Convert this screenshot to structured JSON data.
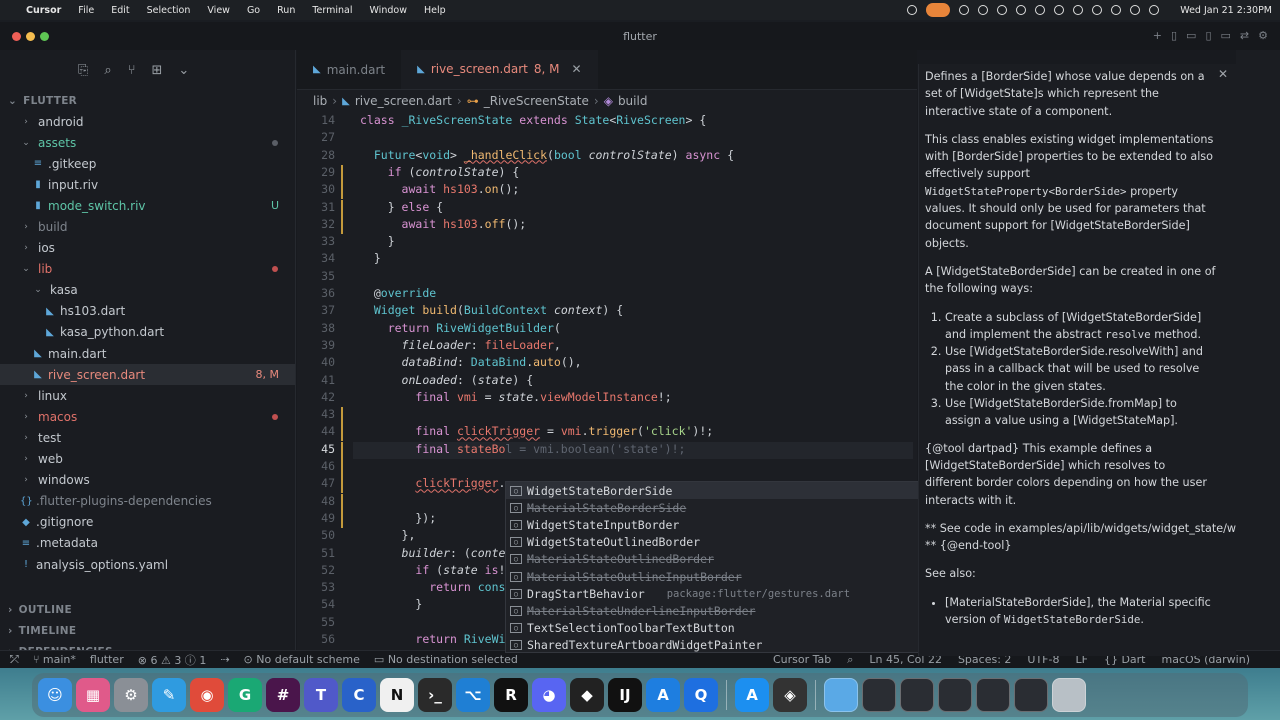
{
  "menubar": {
    "app": "Cursor",
    "items": [
      "File",
      "Edit",
      "Selection",
      "View",
      "Go",
      "Run",
      "Terminal",
      "Window",
      "Help"
    ],
    "datetime": "Wed Jan 21  2:30PM"
  },
  "window": {
    "title": "flutter"
  },
  "sidebar": {
    "root": "FLUTTER",
    "items": [
      {
        "label": "android",
        "chev": "›",
        "depth": 0
      },
      {
        "label": "assets",
        "chev": "⌄",
        "depth": 0,
        "color": "#5ec5a7",
        "dot": "grey"
      },
      {
        "label": ".gitkeep",
        "depth": 1,
        "icon": "≡"
      },
      {
        "label": "input.riv",
        "depth": 1,
        "icon": "▮"
      },
      {
        "label": "mode_switch.riv",
        "depth": 1,
        "icon": "▮",
        "color": "#5ec5a7",
        "badge": "U",
        "badgeColor": "#5ec5a7"
      },
      {
        "label": "build",
        "chev": "›",
        "depth": 0,
        "color": "#7e848c"
      },
      {
        "label": "ios",
        "chev": "›",
        "depth": 0
      },
      {
        "label": "lib",
        "chev": "⌄",
        "depth": 0,
        "color": "#e0726a",
        "dot": "red"
      },
      {
        "label": "kasa",
        "chev": "⌄",
        "depth": 1
      },
      {
        "label": "hs103.dart",
        "depth": 2,
        "icon": "◣"
      },
      {
        "label": "kasa_python.dart",
        "depth": 2,
        "icon": "◣"
      },
      {
        "label": "main.dart",
        "depth": 1,
        "icon": "◣"
      },
      {
        "label": "rive_screen.dart",
        "depth": 1,
        "icon": "◣",
        "color": "#e88a7d",
        "badge": "8, M",
        "badgeColor": "#e88a7d",
        "sel": true
      },
      {
        "label": "linux",
        "chev": "›",
        "depth": 0
      },
      {
        "label": "macos",
        "chev": "›",
        "depth": 0,
        "color": "#e0726a",
        "dot": "red"
      },
      {
        "label": "test",
        "chev": "›",
        "depth": 0
      },
      {
        "label": "web",
        "chev": "›",
        "depth": 0
      },
      {
        "label": "windows",
        "chev": "›",
        "depth": 0
      },
      {
        "label": ".flutter-plugins-dependencies",
        "depth": 0,
        "icon": "{}",
        "color": "#7e848c"
      },
      {
        "label": ".gitignore",
        "depth": 0,
        "icon": "◆"
      },
      {
        "label": ".metadata",
        "depth": 0,
        "icon": "≡"
      },
      {
        "label": "analysis_options.yaml",
        "depth": 0,
        "icon": "!"
      }
    ],
    "sections": [
      "OUTLINE",
      "TIMELINE",
      "DEPENDENCIES"
    ]
  },
  "tabs": [
    {
      "label": "main.dart",
      "badge": ""
    },
    {
      "label": "rive_screen.dart",
      "badge": "8, M"
    }
  ],
  "breadcrumb": [
    "lib",
    "rive_screen.dart",
    "_RiveScreenState",
    "build"
  ],
  "editor": {
    "lines": [
      {
        "n": "14",
        "h": "<span class='k'>class</span> <span class='t'>_RiveScreenState</span> <span class='k'>extends</span> <span class='t'>State</span>&lt;<span class='t'>RiveScreen</span>&gt; {"
      },
      {
        "n": "27",
        "h": ""
      },
      {
        "n": "28",
        "h": "  <span class='t'>Future</span>&lt;<span class='t'>void</span>&gt; <span class='f wav'>_handleClick</span>(<span class='t'>bool</span> <span class='i'>controlState</span>) <span class='k'>async</span> {"
      },
      {
        "n": "29",
        "h": "    <span class='k'>if</span> (<span class='i'>controlState</span>) {",
        "gm": true
      },
      {
        "n": "30",
        "h": "      <span class='k'>await</span> <span class='v'>hs103</span>.<span class='f'>on</span>();",
        "gm": true
      },
      {
        "n": "31",
        "h": "    } <span class='k'>else</span> {",
        "gm": true
      },
      {
        "n": "32",
        "h": "      <span class='k'>await</span> <span class='v'>hs103</span>.<span class='f'>off</span>();",
        "gm": true
      },
      {
        "n": "33",
        "h": "    }"
      },
      {
        "n": "34",
        "h": "  }"
      },
      {
        "n": "35",
        "h": ""
      },
      {
        "n": "36",
        "h": "  @<span class='t'>override</span>"
      },
      {
        "n": "37",
        "h": "  <span class='t'>Widget</span> <span class='f'>build</span>(<span class='t'>BuildContext</span> <span class='i'>context</span>) {"
      },
      {
        "n": "38",
        "h": "    <span class='k'>return</span> <span class='t'>RiveWidgetBuilder</span>("
      },
      {
        "n": "39",
        "h": "      <span class='i'>fileLoader</span>: <span class='v'>fileLoader</span>,"
      },
      {
        "n": "40",
        "h": "      <span class='i'>dataBind</span>: <span class='t'>DataBind</span>.<span class='f'>auto</span>(),"
      },
      {
        "n": "41",
        "h": "      <span class='i'>onLoaded</span>: (<span class='i'>state</span>) {"
      },
      {
        "n": "42",
        "h": "        <span class='k'>final</span> <span class='v'>vmi</span> = <span class='i'>state</span>.<span class='v'>viewModelInstance</span>!;"
      },
      {
        "n": "43",
        "h": "",
        "gm": true
      },
      {
        "n": "44",
        "h": "        <span class='k'>final</span> <span class='v wav'>clickTrigger</span> = <span class='v'>vmi</span>.<span class='f'>trigger</span>(<span class='s'>'click'</span>)!;",
        "gm": true
      },
      {
        "n": "45",
        "h": "        <span class='k'>final</span> <span class='v'>stateBo</span><span class='g'>l = vmi.boolean('state')!;</span>",
        "gm": true,
        "cur": true
      },
      {
        "n": "46",
        "h": "",
        "gm": true
      },
      {
        "n": "47",
        "h": "        <span class='v wav'>clickTrigger</span>.",
        "gm": true
      },
      {
        "n": "48",
        "h": "",
        "gm": true
      },
      {
        "n": "49",
        "h": "        });",
        "gm": true
      },
      {
        "n": "50",
        "h": "      },"
      },
      {
        "n": "51",
        "h": "      <span class='i'>builder</span>: (<span class='i'>conte</span>"
      },
      {
        "n": "52",
        "h": "        <span class='k'>if</span> (<span class='i'>state</span> <span class='k'>is</span>!"
      },
      {
        "n": "53",
        "h": "          <span class='k'>return</span> <span class='t'>cons</span>"
      },
      {
        "n": "54",
        "h": "        }"
      },
      {
        "n": "55",
        "h": ""
      },
      {
        "n": "56",
        "h": "        <span class='k'>return</span> <span class='t'>RiveWidget</span>(<span class='i'>controller</span>: <span class='i'>state</span>.<span class='v'>controller</span>);"
      }
    ]
  },
  "autocomplete": [
    {
      "label": "WidgetStateBorderSide",
      "deprecated": false,
      "sel": true,
      "pkg": ""
    },
    {
      "label": "MaterialStateBorderSide",
      "deprecated": true,
      "pkg": ""
    },
    {
      "label": "WidgetStateInputBorder",
      "deprecated": false,
      "pkg": ""
    },
    {
      "label": "WidgetStateOutlinedBorder",
      "deprecated": false,
      "pkg": ""
    },
    {
      "label": "MaterialStateOutlinedBorder",
      "deprecated": true,
      "pkg": ""
    },
    {
      "label": "MaterialStateOutlineInputBorder",
      "deprecated": true,
      "pkg": ""
    },
    {
      "label": "DragStartBehavior",
      "deprecated": false,
      "pkg": "package:flutter/gestures.dart"
    },
    {
      "label": "MaterialStateUnderlineInputBorder",
      "deprecated": true,
      "pkg": ""
    },
    {
      "label": "TextSelectionToolbarTextButton",
      "deprecated": false,
      "pkg": ""
    },
    {
      "label": "SharedTextureArtboardWidgetPainter",
      "deprecated": false,
      "pkg": ""
    }
  ],
  "docs": {
    "p1": "Defines a [BorderSide] whose value depends on a set of [WidgetState]s which represent the interactive state of a component.",
    "p2a": "This class enables existing widget implementations with [BorderSide] properties to be extended to also effectively support",
    "p2code": "WidgetStateProperty<BorderSide>",
    "p2b": "property values. It should only be used for parameters that document support for [WidgetStateBorderSide] objects.",
    "p3": "A [WidgetStateBorderSide] can be created in one of the following ways:",
    "li1a": "Create a subclass of [WidgetStateBorderSide] and implement the abstract",
    "li1code": "resolve",
    "li1b": "method.",
    "li2": "Use [WidgetStateBorderSide.resolveWith] and pass in a callback that will be used to resolve the color in the given states.",
    "li3": "Use [WidgetStateBorderSide.fromMap] to assign a value using a [WidgetStateMap].",
    "p4": "{@tool dartpad} This example defines a [WidgetStateBorderSide] which resolves to different border colors depending on how the user interacts with it.",
    "p5a": "** See code in examples/api/lib/widgets/widget_state/widget_state_",
    "p5b": "** {@end-tool}",
    "p6": "See also:",
    "li4a": "[MaterialStateBorderSide], the Material specific version of",
    "li4code": "WidgetStateBorderSide",
    "li4b": "."
  },
  "status": {
    "branch": "main*",
    "project": "flutter",
    "errors": "6",
    "warnings": "3",
    "infos": "1",
    "scheme": "No default scheme",
    "destination": "No destination selected",
    "cursor_tab": "Cursor Tab",
    "position": "Ln 45, Col 22",
    "spaces": "Spaces: 2",
    "encoding": "UTF-8",
    "eol": "LF",
    "language": "Dart",
    "platform": "macOS (darwin)"
  },
  "dock": [
    {
      "name": "finder",
      "c": "#3b8fe0",
      "g": "☺"
    },
    {
      "name": "launchpad",
      "c": "#e05a8a",
      "g": "▦"
    },
    {
      "name": "system-settings",
      "c": "#8a8f96",
      "g": "⚙"
    },
    {
      "name": "freeform",
      "c": "#2f9be0",
      "g": "✎"
    },
    {
      "name": "chrome",
      "c": "#e04b3a",
      "g": "◉"
    },
    {
      "name": "grammarly",
      "c": "#1aa874",
      "g": "G"
    },
    {
      "name": "slack",
      "c": "#4a154b",
      "g": "#"
    },
    {
      "name": "teams",
      "c": "#5059c9",
      "g": "T"
    },
    {
      "name": "cursor-app",
      "c": "#2962c9",
      "g": "C"
    },
    {
      "name": "notion",
      "c": "#f0f0f0",
      "g": "N"
    },
    {
      "name": "terminal",
      "c": "#2a2a2a",
      "g": "›_"
    },
    {
      "name": "vscode",
      "c": "#1f7fd4",
      "g": "⌥"
    },
    {
      "name": "rider",
      "c": "#111",
      "g": "R"
    },
    {
      "name": "discord",
      "c": "#5865f2",
      "g": "◕"
    },
    {
      "name": "unity",
      "c": "#222",
      "g": "◆"
    },
    {
      "name": "intellij",
      "c": "#111",
      "g": "IJ"
    },
    {
      "name": "testflight",
      "c": "#1e7ee0",
      "g": "A"
    },
    {
      "name": "quicktime",
      "c": "#1e6fe0",
      "g": "Q"
    },
    {
      "name": "app-store",
      "c": "#1c8ff0",
      "g": "A"
    },
    {
      "name": "davinci",
      "c": "#333",
      "g": "◈"
    }
  ]
}
